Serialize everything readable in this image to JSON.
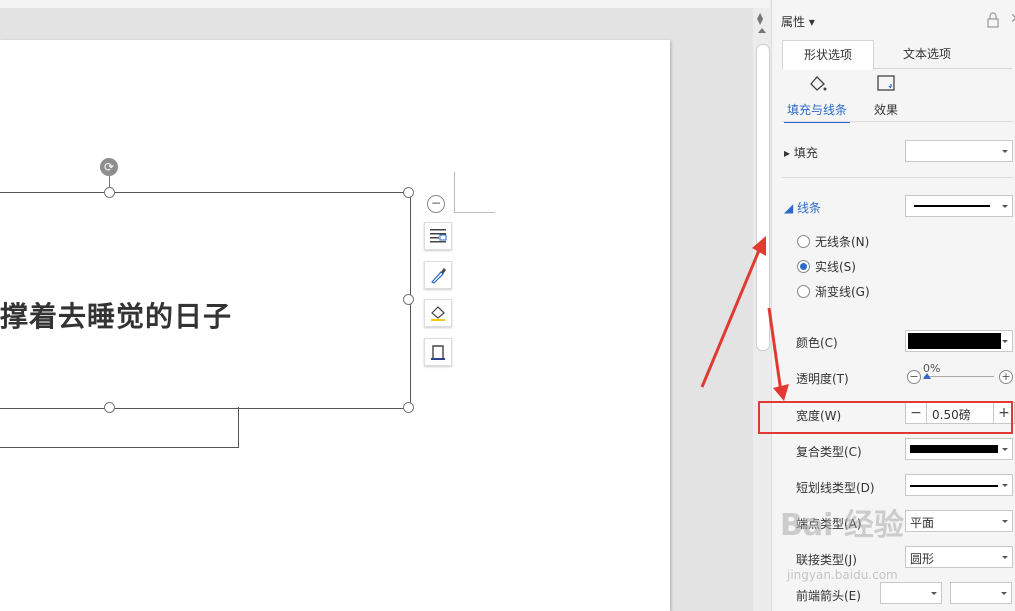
{
  "document": {
    "shape_text": "撑着去睡觉的日子"
  },
  "panel": {
    "title": "属性",
    "tabs": [
      "形状选项",
      "文本选项"
    ],
    "subtabs": [
      "填充与线条",
      "效果"
    ],
    "fill": {
      "label": "填充",
      "value": ""
    },
    "line": {
      "label": "线条",
      "options": [
        "无线条(N)",
        "实线(S)",
        "渐变线(G)"
      ],
      "selected": "实线(S)"
    },
    "color": {
      "label": "颜色(C)",
      "value": "#000000"
    },
    "transparency": {
      "label": "透明度(T)",
      "value": "0%"
    },
    "width": {
      "label": "宽度(W)",
      "value": "0.50磅"
    },
    "compound_type": {
      "label": "复合类型(C)"
    },
    "dash_type": {
      "label": "短划线类型(D)"
    },
    "cap_type": {
      "label": "端点类型(A)",
      "value": "平面"
    },
    "join_type": {
      "label": "联接类型(J)",
      "value": "圆形"
    },
    "begin_arrow": {
      "label": "前端箭头(E)"
    }
  },
  "annotation": {
    "highlight_color": "#e23a33"
  },
  "watermark": {
    "text": "Bai 经验",
    "sub": "jingyan.baidu.com"
  }
}
